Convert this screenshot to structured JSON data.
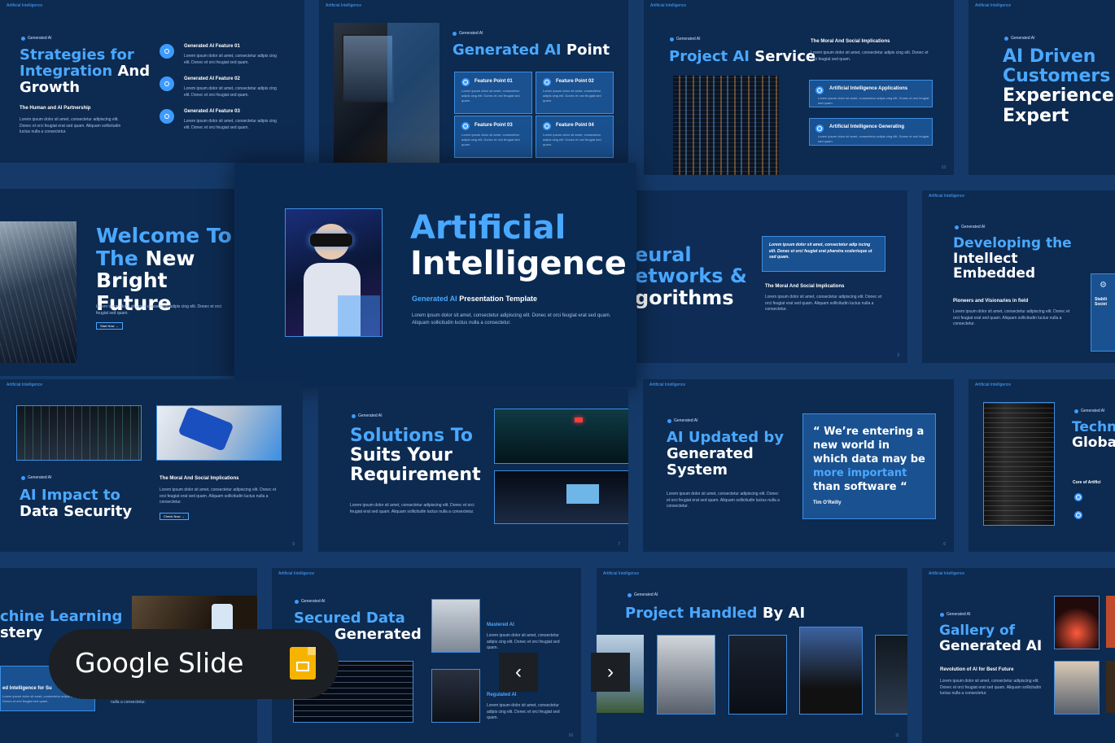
{
  "brand": "Artificial Intelligence",
  "tag": "Generated AI",
  "lorem_short": "Lorem ipsum dolor sit amet, consectetur adipis cing elit. Donec et orci feugiat sed quam.",
  "lorem_long": "Lorem ipsum dolor sit amet, consectetur adipiscing elit. Donec et orci feugiat erat sed quam. Aliquam sollicitudin luctus nulla a consectetur.",
  "s1": {
    "title_a": "Strategies for",
    "title_b": "Integration",
    "title_c": "And",
    "title_d": "Growth",
    "sub": "The Human and AI Partnership",
    "features": [
      "Generated AI Feature 01",
      "Generated AI Feature 02",
      "Generated AI Feature 03"
    ]
  },
  "s2": {
    "title_a": "Generated AI",
    "title_b": "Point",
    "cards": [
      "Feature Point 01",
      "Feature Point 02",
      "Feature Point 03",
      "Feature Point 04"
    ]
  },
  "s3": {
    "title_a": "Project AI",
    "title_b": "Service",
    "heading": "The Moral And Social Implications",
    "items": [
      "Artificial Intelligence Applications",
      "Artificial Intelligence Generating"
    ],
    "page": "13"
  },
  "s4": {
    "title_a": "AI Driven",
    "title_b": "Customers",
    "title_c": "Experience",
    "title_d": "Expert"
  },
  "s5": {
    "title_a": "Welcome To",
    "title_b": "The",
    "title_c": "New",
    "title_d": "Bright Future",
    "btn": "Start Now →"
  },
  "hero": {
    "title_a": "Artificial",
    "title_b": "Intelligence",
    "sub_a": "Generated AI",
    "sub_b": "Presentation Template"
  },
  "s6": {
    "title_a": "eural",
    "title_b": "etworks &",
    "title_c": "gorithms",
    "quote": "Lorem ipsum dolor sit amet, consectetur adip iscing elit. Donec et orci feugiat erat pharetra scelerisque ut sed quam.",
    "heading": "The Moral And Social Implications",
    "page": "3"
  },
  "s7": {
    "title_a": "Developing the",
    "title_b": "Intellect",
    "title_c": "Embedded",
    "sub": "Pioneers and Visionaries in field",
    "side_a": "Stabili",
    "side_b": "Societ"
  },
  "s8": {
    "title_a": "AI Impact to",
    "title_b": "Data Security",
    "heading": "The Moral And Social Implications",
    "btn": "Check Now →",
    "page": "9"
  },
  "s9": {
    "title_a": "Solutions To",
    "title_b": "Suits Your",
    "title_c": "Requirement",
    "page": "7"
  },
  "s10": {
    "title_a": "AI Updated by",
    "title_b": "Generated",
    "title_c": "System",
    "quote_a": "“ We’re entering a new world in which data may be",
    "quote_b": "more important",
    "quote_c": "than software “",
    "author": "Tim O’Reilly",
    "page": "6"
  },
  "s11": {
    "title_a": "Techn",
    "title_b": "Globa",
    "sub": "Core of Artifici"
  },
  "s12": {
    "title_a": "chine Learning",
    "title_b": "stery",
    "sub": "ed Intelligence for Su",
    "lorem": "nulla a consectetur."
  },
  "s13": {
    "title_a": "Secured Data",
    "title_b": "Generated",
    "col_a": "Mastered AI",
    "col_b": "Regulated AI",
    "page": "10"
  },
  "s14": {
    "title_a": "Project Handled",
    "title_b": "By AI",
    "page": "11"
  },
  "s15": {
    "title_a": "Gallery of",
    "title_b": "Generated AI",
    "sub": "Revolution of AI for Best Future"
  },
  "badge": {
    "label": "Google Slide",
    "icon": "google-slides-icon"
  },
  "nav": {
    "prev": "‹",
    "next": "›"
  },
  "colors": {
    "bg": "#153a6a",
    "slide": "#0d2a50",
    "accent": "#4aa8ff",
    "card": "#1a5190"
  }
}
